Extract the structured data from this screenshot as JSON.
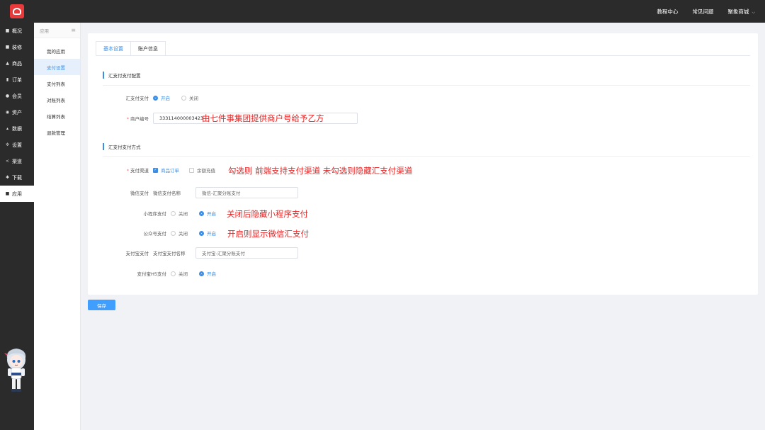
{
  "header": {
    "links": [
      "教程中心",
      "常见问题",
      "聚象商城"
    ]
  },
  "leftnav": {
    "items": [
      {
        "label": "概况",
        "icon": "monitor-icon"
      },
      {
        "label": "装修",
        "icon": "brush-icon"
      },
      {
        "label": "商品",
        "icon": "bag-icon"
      },
      {
        "label": "订单",
        "icon": "order-icon"
      },
      {
        "label": "会员",
        "icon": "user-icon"
      },
      {
        "label": "资产",
        "icon": "wallet-icon"
      },
      {
        "label": "数据",
        "icon": "chart-icon"
      },
      {
        "label": "设置",
        "icon": "gear-icon"
      },
      {
        "label": "渠道",
        "icon": "share-icon"
      },
      {
        "label": "下载",
        "icon": "download-icon"
      },
      {
        "label": "应用",
        "icon": "app-icon"
      }
    ],
    "active_index": 10
  },
  "subnav": {
    "title": "应用",
    "items": [
      "我的应用",
      "支付设置",
      "支付列表",
      "对账列表",
      "结算列表",
      "退款管理"
    ],
    "active_index": 1
  },
  "tabs": [
    "基本设置",
    "账户信息"
  ],
  "section1": {
    "title": "汇支付支付配置",
    "pay_label": "汇支付支付",
    "open": "开启",
    "close": "关闭",
    "merchant_label": "商户编号",
    "merchant_value": "333114000003423",
    "merchant_note": "由七件事集团提供商户号给予乙方"
  },
  "section2": {
    "title": "汇支付支付方式",
    "channel_label": "支付渠道",
    "channel_goods": "商品订单",
    "channel_recharge": "余额充值",
    "channel_note": "勾选则 前端支持支付渠道  未勾选则隐藏汇支付渠道",
    "wechat_label": "微信支付",
    "wechat_name_label": "微信支付名称",
    "wechat_name_value": "微信-汇聚分账支付",
    "mini_label": "小程序支付",
    "mini_close": "关闭",
    "mini_open": "开启",
    "mini_note": "关闭后隐藏小程序支付",
    "mp_label": "公众号支付",
    "mp_close": "关闭",
    "mp_open": "开启",
    "mp_note": "开启则显示微信汇支付",
    "alipay_label": "支付宝支付",
    "alipay_name_label": "支付宝支付名称",
    "alipay_name_value": "支付宝-汇聚分账支付",
    "alipay_h5_label": "支付宝H5支付",
    "alipay_h5_close": "关闭",
    "alipay_h5_open": "开启"
  },
  "save_label": "保存",
  "colors": {
    "accent": "#409eff",
    "annotation": "#e82323",
    "topbar": "#2b2b2b"
  }
}
